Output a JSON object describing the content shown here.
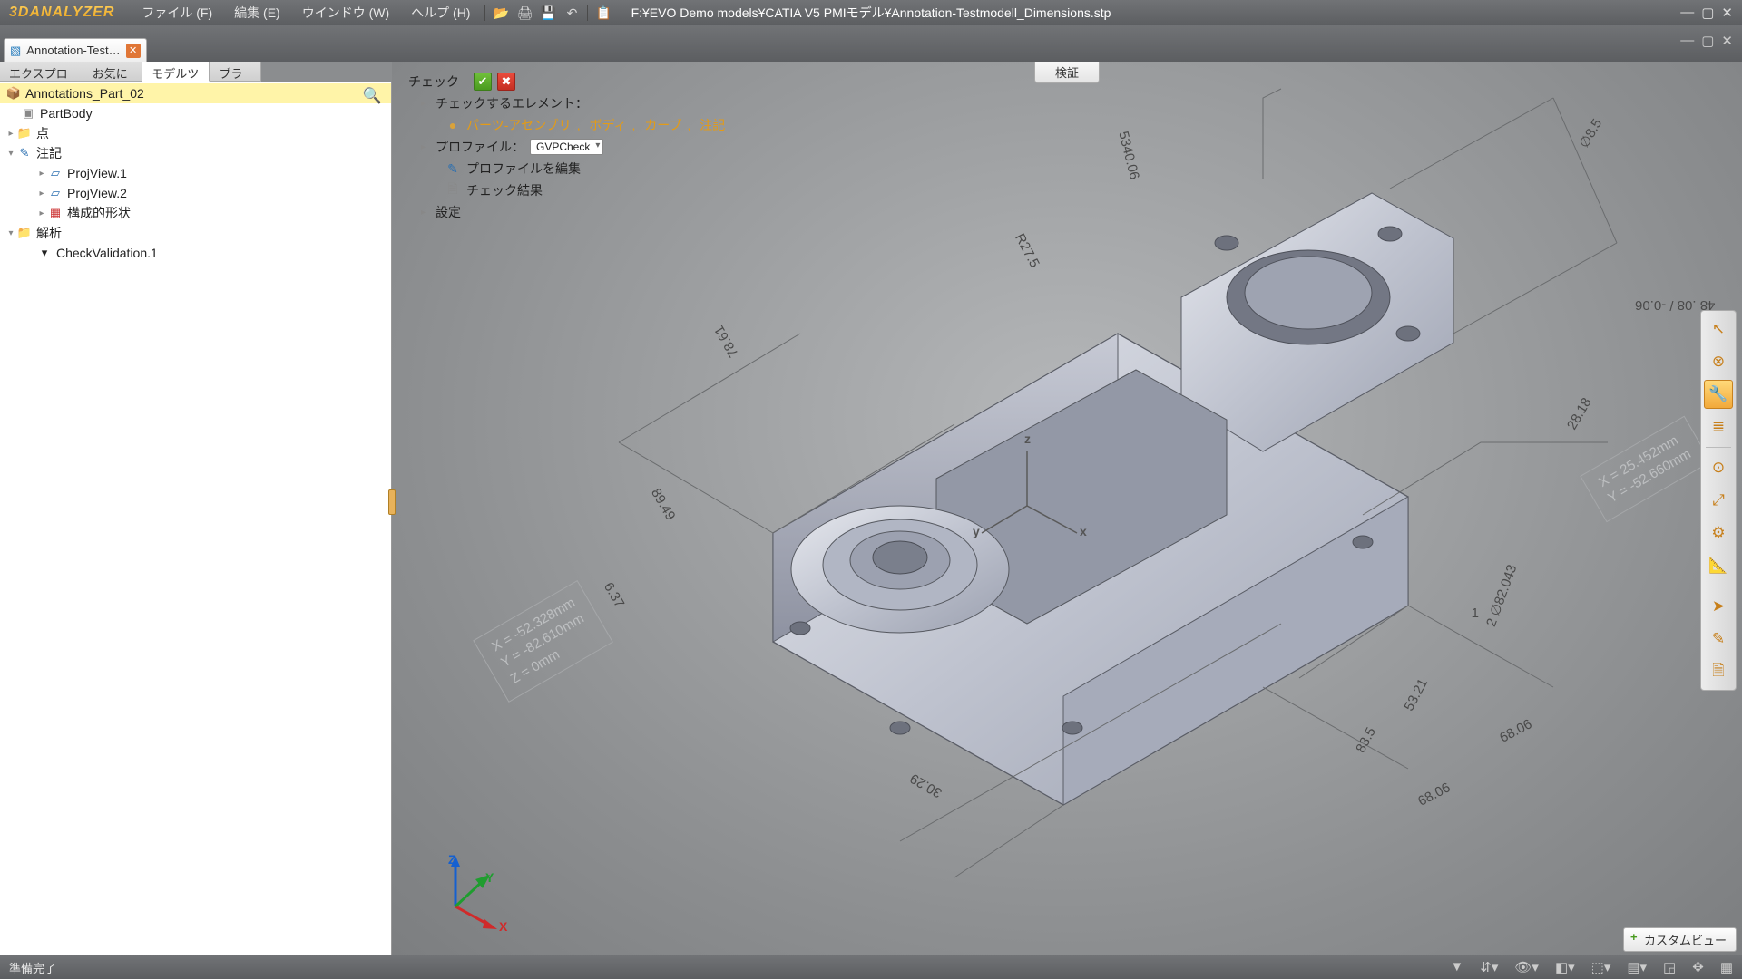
{
  "app": {
    "logo": "3DANALYZER",
    "menus": [
      "ファイル (F)",
      "編集 (E)",
      "ウインドウ (W)",
      "ヘルプ (H)"
    ],
    "title_path": "F:¥EVO Demo models¥CATIA V5 PMIモデル¥Annotation-Testmodell_Dimensions.stp"
  },
  "doctab": {
    "label": "Annotation-Test…"
  },
  "sidetabs": {
    "items": [
      "エクスプローラー",
      "お気に入り",
      "モデルツリー",
      "ブラウザ"
    ],
    "active": 2
  },
  "tree": {
    "root": "Annotations_Part_02",
    "partbody": "PartBody",
    "points": "点",
    "annotations": "注記",
    "projview1": "ProjView.1",
    "projview2": "ProjView.2",
    "constructive": "構成的形状",
    "analysis": "解析",
    "checkval": "CheckValidation.1"
  },
  "check": {
    "title": "チェック",
    "elements_label": "チェックするエレメント：",
    "link_parts": "パーツ-アセンブリ",
    "link_body": "ボディ",
    "link_curve": "カーブ",
    "link_anno": "注記",
    "profile_label": "プロファイル：",
    "profile_value": "GVPCheck",
    "edit_profile": "プロファイルを編集",
    "results": "チェック結果",
    "settings": "設定"
  },
  "validation_tab": "検証",
  "customview": "カスタムビュー",
  "status": {
    "text": "準備完了"
  },
  "dims": {
    "d_8_5": "∅8.5",
    "d_5340_06": "5340.06",
    "d_r27_5": "R27.5",
    "d_48": "48 .08 / -0.06",
    "d_28_18": "28.18",
    "d_78_61": "78.61",
    "d_89_49": "89.49",
    "d_6_37": "6.37",
    "d_phi82": "2 ∅82.043",
    "d_one": "1",
    "d_53_21": "53.21",
    "d_83_5": "83.5",
    "d_30_29": "30.29",
    "d_68_06_a": "68.06",
    "d_68_06_b": "68.06",
    "box1_l1": "X = -52.328mm",
    "box1_l2": "Y = -82.610mm",
    "box1_l3": "Z = 0mm",
    "box2_l1": "X = 25.452mm",
    "box2_l2": "Y = -52.660mm",
    "axis_x": "x",
    "axis_y": "y",
    "axis_z": "z",
    "triad_x": "X",
    "triad_y": "Y",
    "triad_z": "Z"
  }
}
